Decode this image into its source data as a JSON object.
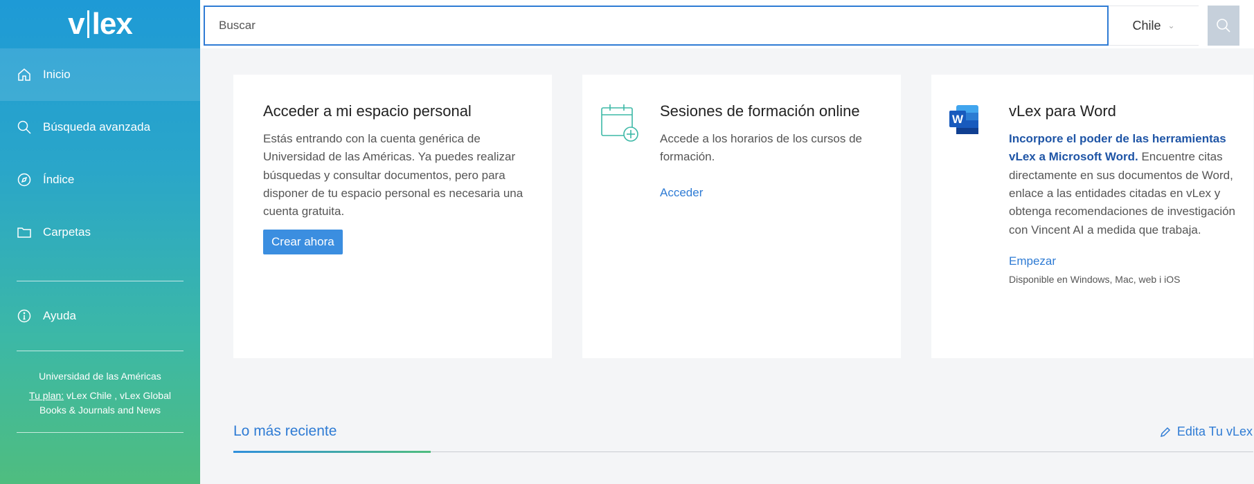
{
  "app": {
    "logo_left": "v",
    "logo_right": "lex"
  },
  "search": {
    "placeholder": "Buscar",
    "country": "Chile"
  },
  "sidebar": {
    "items": [
      {
        "label": "Inicio",
        "icon": "home-icon",
        "active": true
      },
      {
        "label": "Búsqueda avanzada",
        "icon": "search-icon"
      },
      {
        "label": "Índice",
        "icon": "compass-icon"
      },
      {
        "label": "Carpetas",
        "icon": "folder-icon"
      }
    ],
    "help": {
      "label": "Ayuda",
      "icon": "info-icon"
    },
    "org_name": "Universidad de las Américas",
    "plan_link": "Tu plan:",
    "plan_text": " vLex Chile , vLex Global Books & Journals and News"
  },
  "cards": {
    "personal": {
      "title": "Acceder a mi espacio personal",
      "body": "Estás entrando con la cuenta genérica de Universidad de las Américas. Ya puedes realizar búsquedas y consultar documentos, pero para disponer de tu espacio personal es necesaria una cuenta gratuita.",
      "button": "Crear ahora"
    },
    "training": {
      "title": "Sesiones de formación online",
      "body": "Accede a los horarios de los cursos de formación.",
      "link": "Acceder",
      "icon": "calendar-add-icon"
    },
    "word": {
      "title": "vLex para Word",
      "strong": "Incorpore el poder de las herramientas vLex a Microsoft Word.",
      "body": " Encuentre citas directamente en sus documentos de Word, enlace a las entidades citadas en vLex y obtenga recomendaciones de investigación con Vincent AI a medida que trabaja.",
      "link": "Empezar",
      "available": "Disponible en Windows, Mac, web i iOS",
      "icon": "microsoft-word-icon",
      "icon_letter": "W"
    }
  },
  "recent": {
    "title": "Lo más reciente",
    "edit": "Edita Tu vLex"
  },
  "colors": {
    "accent": "#2e7bd4",
    "word_title": "#1f55a6",
    "button": "#3b8ee0"
  }
}
